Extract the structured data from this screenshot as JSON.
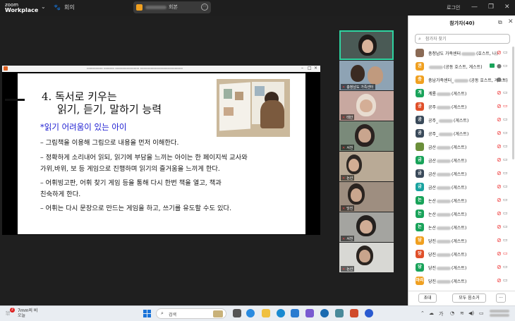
{
  "app": {
    "logo_line1": "zoom",
    "logo_line2": "Workplace",
    "meeting_label": "회의",
    "meeting_pill_text": "회본",
    "login_label": "로그인"
  },
  "slide": {
    "heading_line1": "4. 독서로 키우는",
    "heading_line2": "읽기, 듣기, 말하기 능력",
    "subheading": "*읽기 어려움이 있는 아이",
    "bullets": [
      "– 그림책을 이용해 그림으로 내용을 먼저 이해한다.",
      "– 정확하게 소리내어 읽되, 읽기에 부담을 느끼는 아이는 한 페이지씩 교사와",
      "가위,바위, 보 등 게임으로 진행하며 읽기의 즐거움을 느끼게 한다.",
      "– 어휘빙고판, 어휘 찾기 게임 등을 통해 다시 한번 책을 열고, 책과",
      "친숙하게 한다.",
      "– 어휘는 다시 문장으로 만드는 게임을 하고, 쓰기를 유도할 수도 있다."
    ]
  },
  "videos": [
    {
      "label": ""
    },
    {
      "label": "충청남도 가족센터"
    },
    {
      "label": "태안"
    },
    {
      "label": "서천"
    },
    {
      "label": "논산"
    },
    {
      "label": "당진"
    },
    {
      "label": "서천"
    },
    {
      "label": "논산"
    }
  ],
  "participants_panel": {
    "title": "참가자(40)",
    "search_placeholder": "참가자 찾기",
    "invite_label": "초대",
    "mute_all_label": "모두 음소거",
    "more_label": "···",
    "rows": [
      {
        "avatar": "",
        "color": "#8a6a55",
        "pre": "충청남도 가족센터",
        "post": "(호스트, 나)",
        "mic": "muted",
        "cam": "on"
      },
      {
        "avatar": "권",
        "color": "#f0a020",
        "pre": "",
        "post": "(공동 호스트, 게스트)",
        "mic": "on",
        "cam": "on"
      },
      {
        "avatar": "충",
        "color": "#f0a020",
        "pre": "충남가족센터_",
        "post": "(공동 호스트, 게스트)",
        "mic": "on",
        "cam": "on"
      },
      {
        "avatar": "계",
        "color": "#19a35a",
        "pre": "계룡",
        "post": "(게스트)",
        "mic": "muted",
        "cam": "on"
      },
      {
        "avatar": "공",
        "color": "#e0502a",
        "pre": "공주",
        "post": "(게스트)",
        "mic": "muted",
        "cam": "off"
      },
      {
        "avatar": "공",
        "color": "#3a4a5a",
        "pre": "공주_",
        "post": "(게스트)",
        "mic": "muted",
        "cam": "on"
      },
      {
        "avatar": "공",
        "color": "#3a4a5a",
        "pre": "공주_",
        "post": "(게스트)",
        "mic": "muted",
        "cam": "on"
      },
      {
        "avatar": "",
        "color": "#6b8f3a",
        "pre": "금산",
        "post": "(게스트)",
        "mic": "muted",
        "cam": "on"
      },
      {
        "avatar": "금",
        "color": "#19a35a",
        "pre": "금산",
        "post": "(게스트)",
        "mic": "muted",
        "cam": "on"
      },
      {
        "avatar": "금",
        "color": "#3a4a5a",
        "pre": "금산",
        "post": "(게스트)",
        "mic": "muted",
        "cam": "on"
      },
      {
        "avatar": "금",
        "color": "#19a3a0",
        "pre": "금산",
        "post": "(게스트)",
        "mic": "muted",
        "cam": "on"
      },
      {
        "avatar": "논",
        "color": "#19a35a",
        "pre": "논산",
        "post": "(게스트)",
        "mic": "muted",
        "cam": "on"
      },
      {
        "avatar": "논",
        "color": "#19a35a",
        "pre": "논산",
        "post": "(게스트)",
        "mic": "muted",
        "cam": "on"
      },
      {
        "avatar": "논",
        "color": "#19a35a",
        "pre": "논산",
        "post": "(게스트)",
        "mic": "muted",
        "cam": "on"
      },
      {
        "avatar": "당",
        "color": "#f0a020",
        "pre": "당진",
        "post": "(게스트)",
        "mic": "muted",
        "cam": "on"
      },
      {
        "avatar": "당",
        "color": "#e0502a",
        "pre": "당진",
        "post": "(게스트)",
        "mic": "muted",
        "cam": "off"
      },
      {
        "avatar": "당",
        "color": "#19a35a",
        "pre": "당진",
        "post": "(게스트)",
        "mic": "muted",
        "cam": "on"
      },
      {
        "avatar": "마리",
        "color": "#f0a020",
        "pre": "당진",
        "post": "(게스트)",
        "mic": "muted",
        "cam": "on"
      }
    ]
  },
  "taskbar": {
    "badge": "2",
    "weather_temp": "7mm의 비",
    "weather_sub": "오늘",
    "search_label": "검색"
  }
}
